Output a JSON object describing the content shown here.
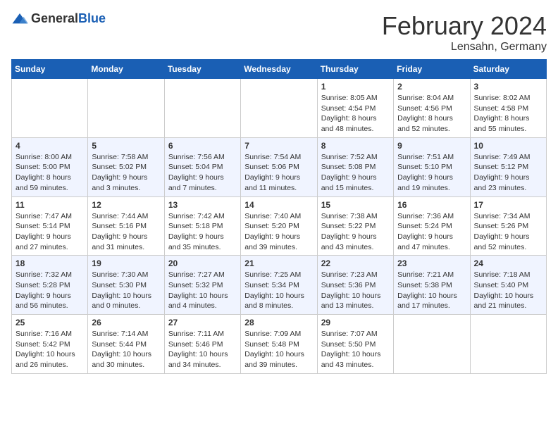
{
  "header": {
    "logo_general": "General",
    "logo_blue": "Blue",
    "month_title": "February 2024",
    "location": "Lensahn, Germany"
  },
  "weekdays": [
    "Sunday",
    "Monday",
    "Tuesday",
    "Wednesday",
    "Thursday",
    "Friday",
    "Saturday"
  ],
  "weeks": [
    [
      {
        "day": "",
        "info": ""
      },
      {
        "day": "",
        "info": ""
      },
      {
        "day": "",
        "info": ""
      },
      {
        "day": "",
        "info": ""
      },
      {
        "day": "1",
        "info": "Sunrise: 8:05 AM\nSunset: 4:54 PM\nDaylight: 8 hours\nand 48 minutes."
      },
      {
        "day": "2",
        "info": "Sunrise: 8:04 AM\nSunset: 4:56 PM\nDaylight: 8 hours\nand 52 minutes."
      },
      {
        "day": "3",
        "info": "Sunrise: 8:02 AM\nSunset: 4:58 PM\nDaylight: 8 hours\nand 55 minutes."
      }
    ],
    [
      {
        "day": "4",
        "info": "Sunrise: 8:00 AM\nSunset: 5:00 PM\nDaylight: 8 hours\nand 59 minutes."
      },
      {
        "day": "5",
        "info": "Sunrise: 7:58 AM\nSunset: 5:02 PM\nDaylight: 9 hours\nand 3 minutes."
      },
      {
        "day": "6",
        "info": "Sunrise: 7:56 AM\nSunset: 5:04 PM\nDaylight: 9 hours\nand 7 minutes."
      },
      {
        "day": "7",
        "info": "Sunrise: 7:54 AM\nSunset: 5:06 PM\nDaylight: 9 hours\nand 11 minutes."
      },
      {
        "day": "8",
        "info": "Sunrise: 7:52 AM\nSunset: 5:08 PM\nDaylight: 9 hours\nand 15 minutes."
      },
      {
        "day": "9",
        "info": "Sunrise: 7:51 AM\nSunset: 5:10 PM\nDaylight: 9 hours\nand 19 minutes."
      },
      {
        "day": "10",
        "info": "Sunrise: 7:49 AM\nSunset: 5:12 PM\nDaylight: 9 hours\nand 23 minutes."
      }
    ],
    [
      {
        "day": "11",
        "info": "Sunrise: 7:47 AM\nSunset: 5:14 PM\nDaylight: 9 hours\nand 27 minutes."
      },
      {
        "day": "12",
        "info": "Sunrise: 7:44 AM\nSunset: 5:16 PM\nDaylight: 9 hours\nand 31 minutes."
      },
      {
        "day": "13",
        "info": "Sunrise: 7:42 AM\nSunset: 5:18 PM\nDaylight: 9 hours\nand 35 minutes."
      },
      {
        "day": "14",
        "info": "Sunrise: 7:40 AM\nSunset: 5:20 PM\nDaylight: 9 hours\nand 39 minutes."
      },
      {
        "day": "15",
        "info": "Sunrise: 7:38 AM\nSunset: 5:22 PM\nDaylight: 9 hours\nand 43 minutes."
      },
      {
        "day": "16",
        "info": "Sunrise: 7:36 AM\nSunset: 5:24 PM\nDaylight: 9 hours\nand 47 minutes."
      },
      {
        "day": "17",
        "info": "Sunrise: 7:34 AM\nSunset: 5:26 PM\nDaylight: 9 hours\nand 52 minutes."
      }
    ],
    [
      {
        "day": "18",
        "info": "Sunrise: 7:32 AM\nSunset: 5:28 PM\nDaylight: 9 hours\nand 56 minutes."
      },
      {
        "day": "19",
        "info": "Sunrise: 7:30 AM\nSunset: 5:30 PM\nDaylight: 10 hours\nand 0 minutes."
      },
      {
        "day": "20",
        "info": "Sunrise: 7:27 AM\nSunset: 5:32 PM\nDaylight: 10 hours\nand 4 minutes."
      },
      {
        "day": "21",
        "info": "Sunrise: 7:25 AM\nSunset: 5:34 PM\nDaylight: 10 hours\nand 8 minutes."
      },
      {
        "day": "22",
        "info": "Sunrise: 7:23 AM\nSunset: 5:36 PM\nDaylight: 10 hours\nand 13 minutes."
      },
      {
        "day": "23",
        "info": "Sunrise: 7:21 AM\nSunset: 5:38 PM\nDaylight: 10 hours\nand 17 minutes."
      },
      {
        "day": "24",
        "info": "Sunrise: 7:18 AM\nSunset: 5:40 PM\nDaylight: 10 hours\nand 21 minutes."
      }
    ],
    [
      {
        "day": "25",
        "info": "Sunrise: 7:16 AM\nSunset: 5:42 PM\nDaylight: 10 hours\nand 26 minutes."
      },
      {
        "day": "26",
        "info": "Sunrise: 7:14 AM\nSunset: 5:44 PM\nDaylight: 10 hours\nand 30 minutes."
      },
      {
        "day": "27",
        "info": "Sunrise: 7:11 AM\nSunset: 5:46 PM\nDaylight: 10 hours\nand 34 minutes."
      },
      {
        "day": "28",
        "info": "Sunrise: 7:09 AM\nSunset: 5:48 PM\nDaylight: 10 hours\nand 39 minutes."
      },
      {
        "day": "29",
        "info": "Sunrise: 7:07 AM\nSunset: 5:50 PM\nDaylight: 10 hours\nand 43 minutes."
      },
      {
        "day": "",
        "info": ""
      },
      {
        "day": "",
        "info": ""
      }
    ]
  ]
}
